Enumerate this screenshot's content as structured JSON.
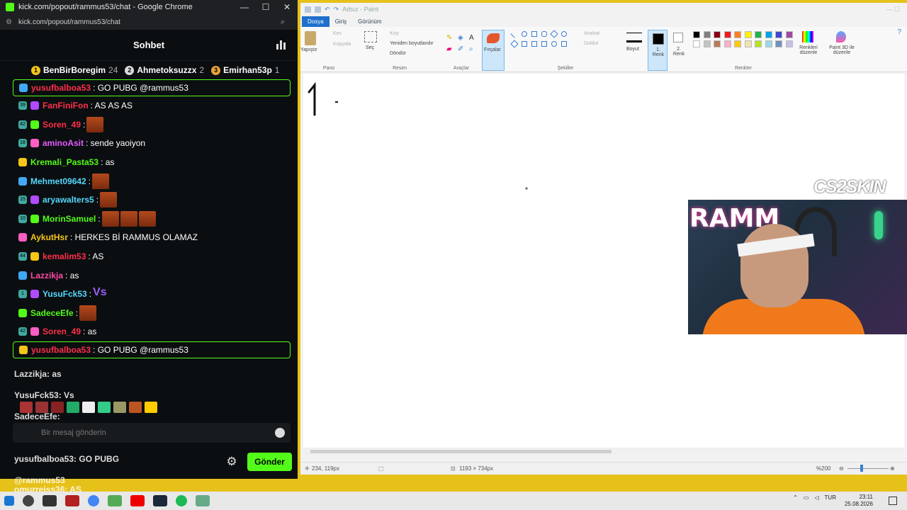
{
  "chrome": {
    "title": "kick.com/popout/rammus53/chat - Google Chrome",
    "url": "kick.com/popout/rammus53/chat"
  },
  "chat": {
    "title": "Sohbet",
    "leaderboard": [
      {
        "name": "BenBirBoregim",
        "count": "24",
        "medal": "1",
        "color": "#f5c518"
      },
      {
        "name": "Ahmetoksuzzx",
        "count": "2",
        "medal": "2",
        "color": "#d9d9d9"
      },
      {
        "name": "Emirhan53p",
        "count": "1",
        "medal": "3",
        "color": "#e8a33a"
      }
    ],
    "messages": [
      {
        "badge": "",
        "user": "yusufbalboa53",
        "userColor": "#ff2e4a",
        "text": ": GO PUBG @rammus53",
        "emotes": 0,
        "pinned": true
      },
      {
        "badge": "39",
        "user": "FanFiniFon",
        "userColor": "#ff2e4a",
        "text": ": AS AS AS",
        "emotes": 0
      },
      {
        "badge": "42",
        "user": "Soren_49",
        "userColor": "#ff2e4a",
        "text": ":",
        "emotes": 1
      },
      {
        "badge": "18",
        "user": "aminoAsit",
        "userColor": "#e25bff",
        "text": ": sende yaoiyon",
        "emotes": 0
      },
      {
        "badge": "",
        "user": "Kremali_Pasta53",
        "userColor": "#53fc18",
        "text": ": as",
        "emotes": 0
      },
      {
        "badge": "",
        "user": "Mehmet09642",
        "userColor": "#53d8fc",
        "text": ":",
        "emotes": 1
      },
      {
        "badge": "15",
        "user": "aryawalters5",
        "userColor": "#53d8fc",
        "text": ":",
        "emotes": 1
      },
      {
        "badge": "10",
        "user": "MorinSamuel",
        "userColor": "#53fc18",
        "text": ":",
        "emotes": 3
      },
      {
        "badge": "",
        "user": "AykutHsr",
        "userColor": "#f5c518",
        "text": ": HERKES Bİ RAMMUS OLAMAZ",
        "emotes": 0
      },
      {
        "badge": "44",
        "user": "kemalim53",
        "userColor": "#ff2e4a",
        "text": ": AS",
        "emotes": 0
      },
      {
        "badge": "",
        "user": "Lazzikja",
        "userColor": "#ff4aa5",
        "text": ": as",
        "emotes": 0
      },
      {
        "badge": "1",
        "user": "YusuFck53",
        "userColor": "#53d8fc",
        "text": ":",
        "emotes": 0,
        "vs": "Vs"
      },
      {
        "badge": "",
        "user": "SadeceEfe",
        "userColor": "#53fc18",
        "text": ":",
        "emotes": 1
      },
      {
        "badge": "42",
        "user": "Soren_49",
        "userColor": "#ff2e4a",
        "text": ": as",
        "emotes": 0
      },
      {
        "badge": "",
        "user": "yusufbalboa53",
        "userColor": "#ff2e4a",
        "text": ": GO PUBG @rammus53",
        "emotes": 0,
        "pinned": true
      }
    ],
    "echo": [
      {
        "text": "omurreiss36: AS"
      },
      {
        "text": "Lazzikja: as"
      },
      {
        "text": "YusuFck53: Vs"
      },
      {
        "text": "SadeceEfe:"
      },
      {
        "text": "Soren_49: as"
      },
      {
        "text": "yusufbalboa53: GO PUBG"
      },
      {
        "text": "@rammus53"
      },
      {
        "text": "omurreiss36: AS"
      }
    ],
    "input_placeholder": "Bir mesaj gönderin",
    "send_label": "Gönder"
  },
  "paint": {
    "title": "Adsız - Paint",
    "tabs": [
      "Dosya",
      "Giriş",
      "Görünüm"
    ],
    "ribbon": {
      "paste": "Yapıştır",
      "cut": "Kes",
      "copy": "Kopyala",
      "select": "Seç",
      "crop": "Kırp",
      "resize": "Yeniden boyutlandır",
      "rotate": "Döndür",
      "brushes": "Fırçalar",
      "outline": "Anahat",
      "fill": "Doldur",
      "size": "Boyut",
      "color1": "1. Renk",
      "color2": "2. Renk",
      "edit_colors": "Renkleri düzenle",
      "paint3d": "Paint 3D ile düzenle",
      "groups": [
        "Pano",
        "Resim",
        "Araçlar",
        "Şekiller",
        "Renkler"
      ]
    },
    "palette": [
      "#000000",
      "#7f7f7f",
      "#880015",
      "#ed1c24",
      "#ff7f27",
      "#fff200",
      "#22b14c",
      "#00a2e8",
      "#3f48cc",
      "#a349a4",
      "#ffffff",
      "#c3c3c3",
      "#b97a57",
      "#ffaec9",
      "#ffc90e",
      "#efe4b0",
      "#b5e61d",
      "#99d9ea",
      "#7092be",
      "#c8bfe7"
    ],
    "canvas_text": "1",
    "status": {
      "cursor": "234, 119px",
      "size": "1193 × 734px",
      "zoom": "%200"
    }
  },
  "overlay": {
    "brand": "CS2SKIN",
    "webcam_text": "RAMM"
  },
  "taskbar": {
    "lang": "TUR",
    "time": "23:11",
    "date": "25.08.2026"
  }
}
